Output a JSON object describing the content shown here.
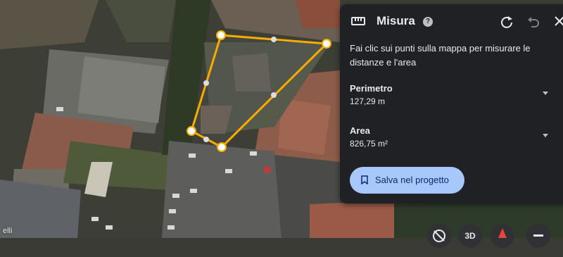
{
  "panel": {
    "title": "Misura",
    "help_glyph": "?",
    "instructions": "Fai clic sui punti sulla mappa per misurare le distanze e l'area",
    "perimeter_label": "Perimetro",
    "perimeter_value": "127,29 m",
    "area_label": "Area",
    "area_value": "826,75 m²",
    "save_label": "Salva nel progetto",
    "icons": [
      "ruler-icon",
      "help-icon",
      "refresh-icon",
      "undo-icon",
      "close-icon",
      "bookmark-icon"
    ]
  },
  "map": {
    "street_label_partial": "elli",
    "controls": {
      "view_3d_label": "3D"
    },
    "icons": [
      "compass-icon",
      "pegman-icon",
      "zoom-out-icon"
    ]
  },
  "colors": {
    "panel_bg": "#202124",
    "button_bg": "#a8c7fa",
    "button_text": "#062e6f",
    "measure_line": "#f9ab00"
  }
}
